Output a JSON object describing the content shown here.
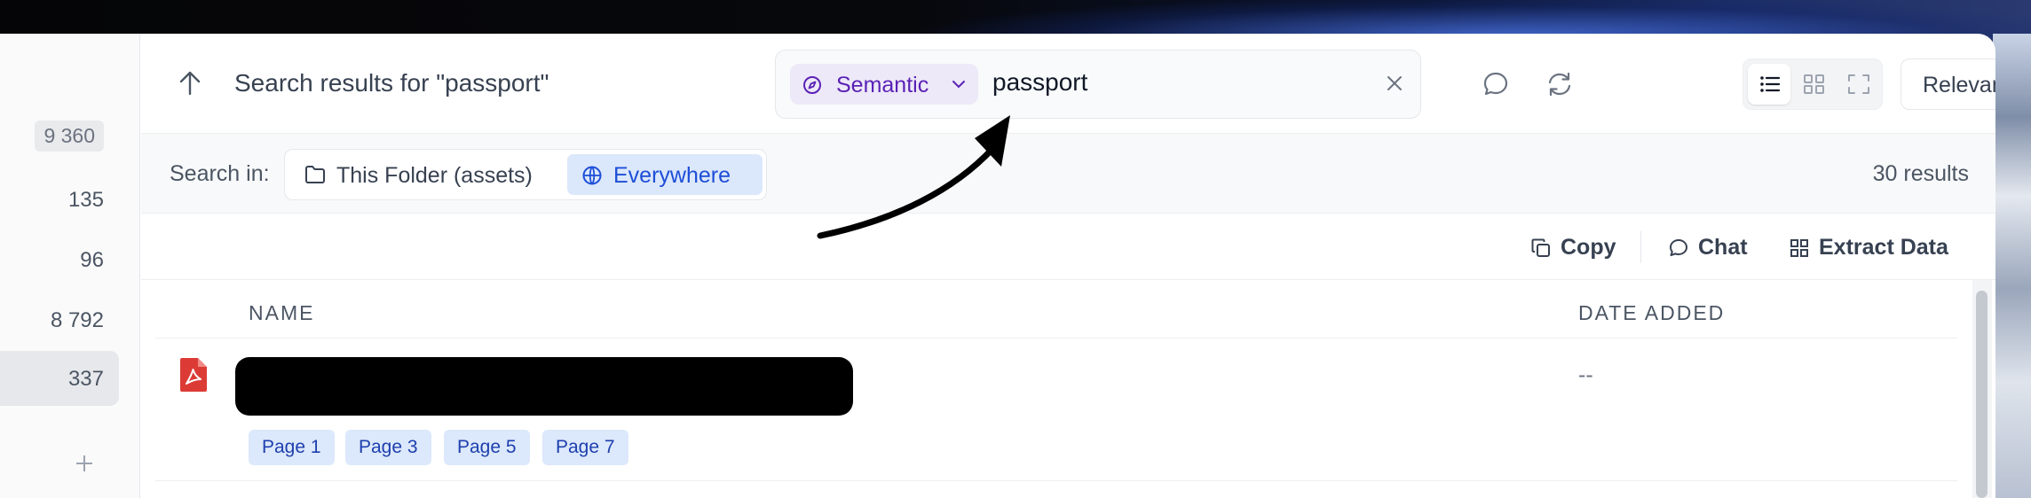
{
  "left_counts": [
    {
      "value": "9 360",
      "style": "badge"
    },
    {
      "value": "135",
      "style": "plain"
    },
    {
      "value": "96",
      "style": "plain"
    },
    {
      "value": "8 792",
      "style": "plain"
    },
    {
      "value": "337",
      "style": "selected"
    }
  ],
  "header": {
    "title": "Search results for \"passport\"",
    "search": {
      "mode": "Semantic",
      "value": "passport"
    },
    "sort": "Relevance"
  },
  "scope": {
    "label": "Search in:",
    "options": [
      "This Folder (assets)",
      "Everywhere"
    ],
    "active": "Everywhere",
    "results_count": "30 results"
  },
  "actions": {
    "copy": "Copy",
    "chat": "Chat",
    "extract": "Extract Data"
  },
  "table": {
    "columns": {
      "name": "NAME",
      "date": "DATE ADDED"
    },
    "rows": [
      {
        "pages": [
          "Page 1",
          "Page 3",
          "Page 5",
          "Page 7"
        ],
        "date": "--"
      }
    ]
  },
  "colors": {
    "accent_purple": "#5b21b6",
    "accent_blue": "#1d4ed8",
    "pdf_red": "#dc3b35"
  }
}
